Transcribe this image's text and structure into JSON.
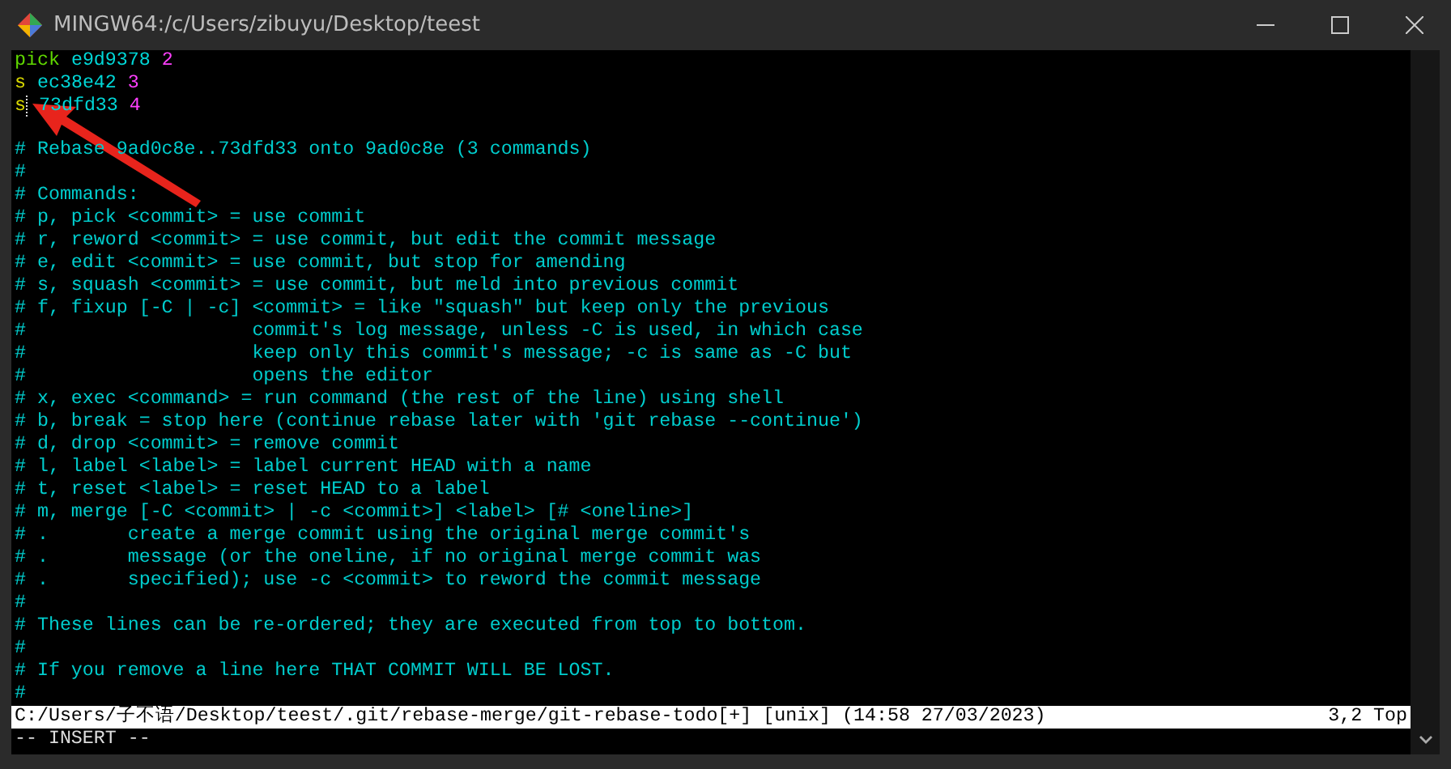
{
  "window": {
    "title": "MINGW64:/c/Users/zibuyu/Desktop/teest"
  },
  "todo_lines": [
    {
      "kind": "pick",
      "command": "pick",
      "hash": "e9d9378",
      "message": "2",
      "cursor": false
    },
    {
      "kind": "squash",
      "command": "s",
      "hash": "ec38e42",
      "message": "3",
      "cursor": false
    },
    {
      "kind": "squash",
      "command": "s",
      "hash": "73dfd33",
      "message": "4",
      "cursor": true
    }
  ],
  "comment_lines": [
    "# Rebase 9ad0c8e..73dfd33 onto 9ad0c8e (3 commands)",
    "#",
    "# Commands:",
    "# p, pick <commit> = use commit",
    "# r, reword <commit> = use commit, but edit the commit message",
    "# e, edit <commit> = use commit, but stop for amending",
    "# s, squash <commit> = use commit, but meld into previous commit",
    "# f, fixup [-C | -c] <commit> = like \"squash\" but keep only the previous",
    "#                    commit's log message, unless -C is used, in which case",
    "#                    keep only this commit's message; -c is same as -C but",
    "#                    opens the editor",
    "# x, exec <command> = run command (the rest of the line) using shell",
    "# b, break = stop here (continue rebase later with 'git rebase --continue')",
    "# d, drop <commit> = remove commit",
    "# l, label <label> = label current HEAD with a name",
    "# t, reset <label> = reset HEAD to a label",
    "# m, merge [-C <commit> | -c <commit>] <label> [# <oneline>]",
    "# .       create a merge commit using the original merge commit's",
    "# .       message (or the oneline, if no original merge commit was",
    "# .       specified); use -c <commit> to reword the commit message",
    "#",
    "# These lines can be re-ordered; they are executed from top to bottom.",
    "#",
    "# If you remove a line here THAT COMMIT WILL BE LOST.",
    "#"
  ],
  "status_line": {
    "file": "C:/Users/子不语/Desktop/teest/.git/rebase-merge/git-rebase-todo[+] [unix] (14:58 27/03/2023)",
    "position": "3,2 Top"
  },
  "mode_line": "-- INSERT --"
}
